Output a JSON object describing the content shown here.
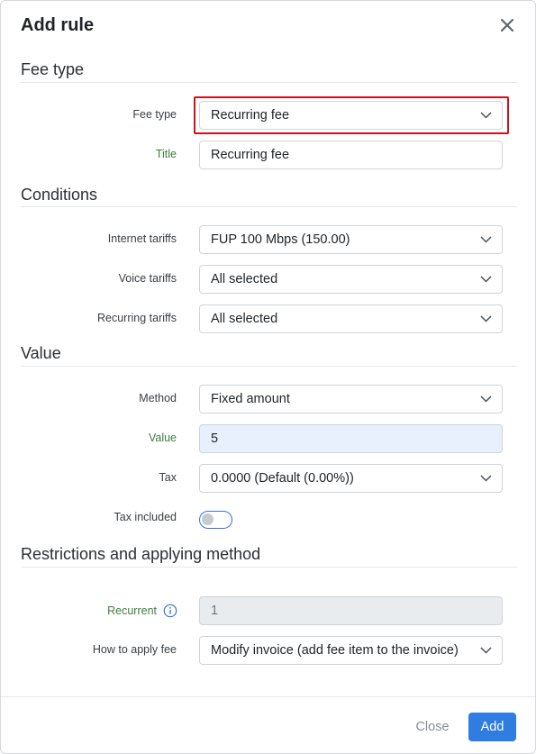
{
  "dialog": {
    "title": "Add rule",
    "close_icon": "close-icon"
  },
  "sections": {
    "fee_type": "Fee type",
    "conditions": "Conditions",
    "value": "Value",
    "restrictions": "Restrictions and applying method"
  },
  "fields": {
    "fee_type": {
      "label": "Fee type",
      "value": "Recurring fee"
    },
    "title": {
      "label": "Title",
      "value": "Recurring fee"
    },
    "internet_tariffs": {
      "label": "Internet tariffs",
      "value": "FUP 100 Mbps (150.00)"
    },
    "voice_tariffs": {
      "label": "Voice tariffs",
      "value": "All selected"
    },
    "recurring_tariffs": {
      "label": "Recurring tariffs",
      "value": "All selected"
    },
    "method": {
      "label": "Method",
      "value": "Fixed amount"
    },
    "value": {
      "label": "Value",
      "value": "5"
    },
    "tax": {
      "label": "Tax",
      "value": "0.0000 (Default (0.00%))"
    },
    "tax_included": {
      "label": "Tax included",
      "checked": false
    },
    "recurrent": {
      "label": "Recurrent",
      "value": "1"
    },
    "how_to_apply": {
      "label": "How to apply fee",
      "value": "Modify invoice (add fee item to the invoice)"
    }
  },
  "footer": {
    "close_label": "Close",
    "add_label": "Add"
  },
  "colors": {
    "primary": "#2f7de1",
    "highlight_border": "#c9151b",
    "required_label": "#3c7d3e",
    "autofill_bg": "#e8f0fe"
  }
}
